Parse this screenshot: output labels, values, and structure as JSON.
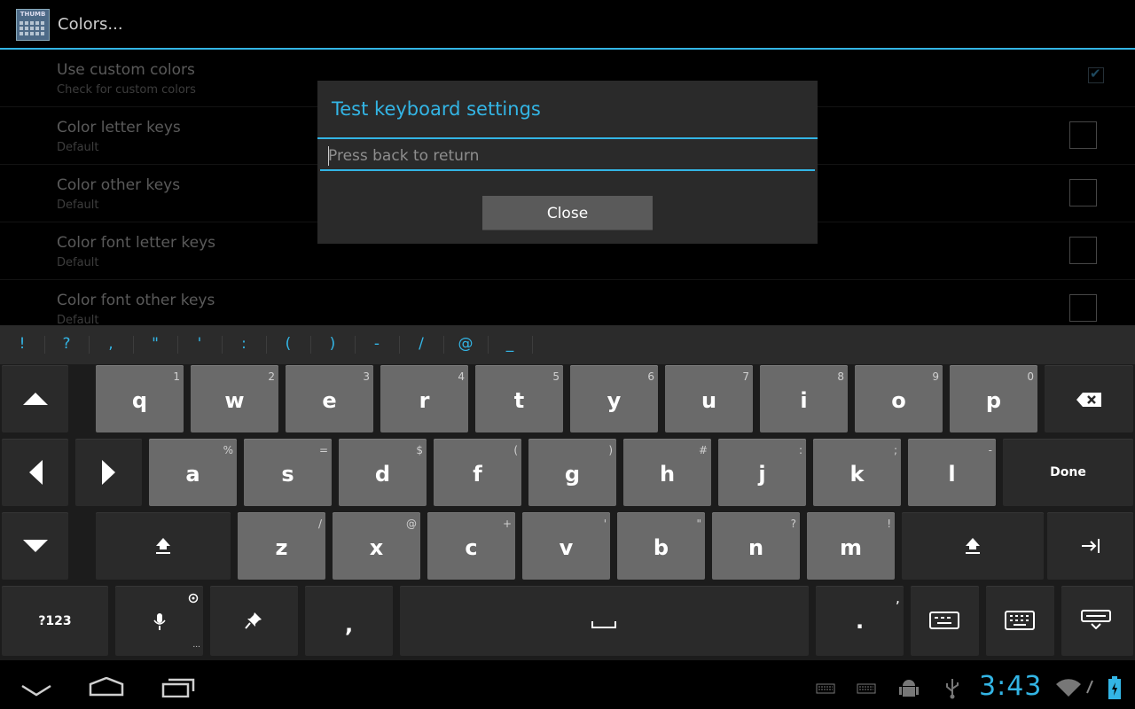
{
  "app": {
    "title": "Colors...",
    "icon_text": "THUMB"
  },
  "prefs": [
    {
      "title": "Use custom colors",
      "summary": "Check for custom colors",
      "checked": true
    },
    {
      "title": "Color letter keys",
      "summary": "Default",
      "checked": false
    },
    {
      "title": "Color other keys",
      "summary": "Default",
      "checked": false
    },
    {
      "title": "Color font letter keys",
      "summary": "Default",
      "checked": false
    },
    {
      "title": "Color font other keys",
      "summary": "Default",
      "checked": false
    }
  ],
  "dialog": {
    "title": "Test keyboard settings",
    "input_placeholder": "Press back to return",
    "close_label": "Close"
  },
  "keyboard": {
    "symbols": [
      "!",
      "?",
      ",",
      "\"",
      "'",
      ":",
      "(",
      ")",
      "-",
      "/",
      "@",
      "_"
    ],
    "row1": [
      {
        "main": "q",
        "hint": "1"
      },
      {
        "main": "w",
        "hint": "2"
      },
      {
        "main": "e",
        "hint": "3"
      },
      {
        "main": "r",
        "hint": "4"
      },
      {
        "main": "t",
        "hint": "5"
      },
      {
        "main": "y",
        "hint": "6"
      },
      {
        "main": "u",
        "hint": "7"
      },
      {
        "main": "i",
        "hint": "8"
      },
      {
        "main": "o",
        "hint": "9"
      },
      {
        "main": "p",
        "hint": "0"
      }
    ],
    "row2": [
      {
        "main": "a",
        "hint": "%"
      },
      {
        "main": "s",
        "hint": "="
      },
      {
        "main": "d",
        "hint": "$"
      },
      {
        "main": "f",
        "hint": "("
      },
      {
        "main": "g",
        "hint": ")"
      },
      {
        "main": "h",
        "hint": "#"
      },
      {
        "main": "j",
        "hint": ":"
      },
      {
        "main": "k",
        "hint": ";"
      },
      {
        "main": "l",
        "hint": "-"
      }
    ],
    "row3": [
      {
        "main": "z",
        "hint": "/"
      },
      {
        "main": "x",
        "hint": "@"
      },
      {
        "main": "c",
        "hint": "+"
      },
      {
        "main": "v",
        "hint": "'"
      },
      {
        "main": "b",
        "hint": "\""
      },
      {
        "main": "n",
        "hint": "?"
      },
      {
        "main": "m",
        "hint": "!"
      }
    ],
    "done_label": "Done",
    "numbers_label": "?123",
    "comma_label": ",",
    "period_label": ".",
    "period_hint": ",",
    "mic_hint": "..."
  },
  "status": {
    "time": "3:43"
  },
  "colors": {
    "accent": "#33b5e5",
    "key_light": "#6a6a6a",
    "key_dark": "#2a2a2a"
  },
  "icons": [
    "up-arrow-icon",
    "backspace-icon",
    "left-arrow-icon",
    "right-arrow-icon",
    "down-arrow-icon",
    "shift-icon",
    "tab-icon",
    "mic-icon",
    "pin-icon",
    "keyboard-icon",
    "keyboard-hide-icon",
    "back-icon",
    "home-icon",
    "recents-icon",
    "usb-icon",
    "android-debug-icon",
    "wifi-icon",
    "battery-icon"
  ]
}
